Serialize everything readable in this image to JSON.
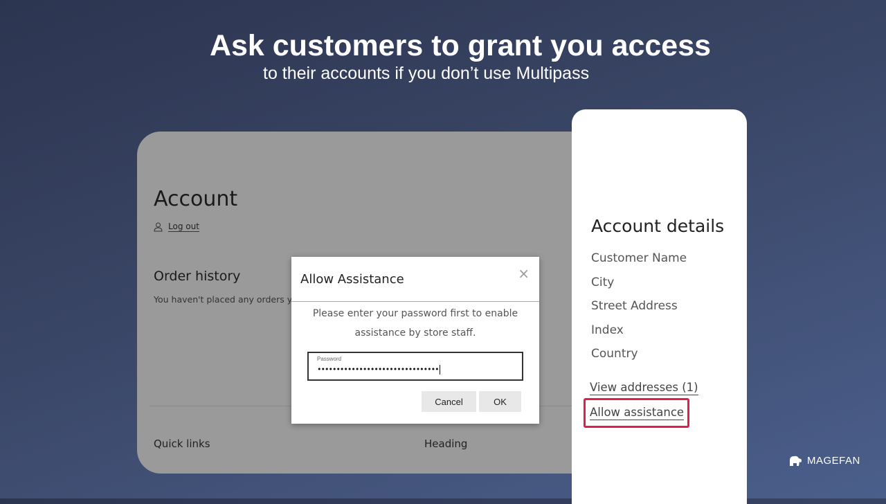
{
  "headline": {
    "title": "Ask customers to grant you access",
    "subtitle": "to their accounts if you don’t use Multipass"
  },
  "account": {
    "title": "Account",
    "logout": "Log out",
    "order_history": "Order history",
    "no_orders": "You haven't placed any orders yet.",
    "quick_links": "Quick links",
    "heading": "Heading"
  },
  "dialog": {
    "title": "Allow Assistance",
    "close": "×",
    "message": "Please enter your password first to enable assistance by store staff.",
    "password_label": "Password",
    "password_value": "••••••••••••••••••••••••••••••••",
    "cancel": "Cancel",
    "ok": "OK"
  },
  "details": {
    "title": "Account details",
    "items": [
      "Customer Name",
      "City",
      "Street Address",
      "Index",
      "Country"
    ],
    "view_addresses": "View addresses (1)",
    "allow_assistance": "Allow assistance"
  },
  "brand": {
    "logo_text": "MAGEFAN",
    "highlight_color": "#e11d48"
  }
}
